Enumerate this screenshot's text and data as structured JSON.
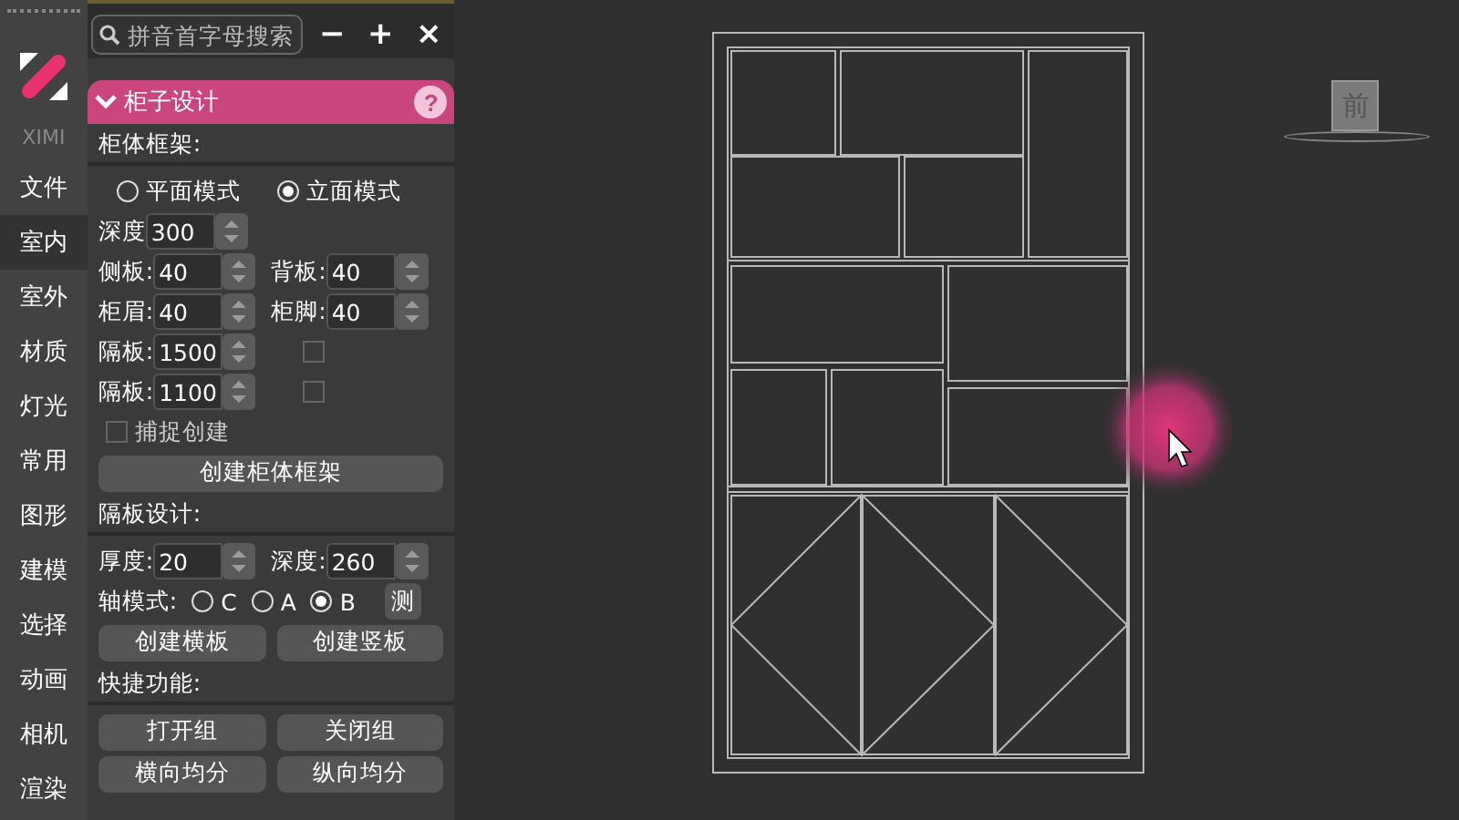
{
  "sidebar": {
    "brand": "XIMI",
    "items": [
      {
        "label": "文件",
        "selected": false
      },
      {
        "label": "室内",
        "selected": true
      },
      {
        "label": "室外",
        "selected": false
      },
      {
        "label": "材质",
        "selected": false
      },
      {
        "label": "灯光",
        "selected": false
      },
      {
        "label": "常用",
        "selected": false
      },
      {
        "label": "图形",
        "selected": false
      },
      {
        "label": "建模",
        "selected": false
      },
      {
        "label": "选择",
        "selected": false
      },
      {
        "label": "动画",
        "selected": false
      },
      {
        "label": "相机",
        "selected": false
      },
      {
        "label": "渲染",
        "selected": false
      }
    ]
  },
  "panel": {
    "search": {
      "placeholder": "拼音首字母搜索"
    },
    "tools": [
      "−",
      "+",
      "×"
    ],
    "header": {
      "title": "柜子设计",
      "expanded": true,
      "help": "?"
    },
    "form": [
      {
        "kind": "heading",
        "text": "柜体框架:"
      },
      {
        "kind": "radios",
        "options": [
          {
            "label": "平面模式",
            "selected": false
          },
          {
            "label": "立面模式",
            "selected": true
          }
        ]
      },
      {
        "kind": "fields",
        "fields": [
          {
            "label": "深度",
            "value": "300"
          }
        ]
      },
      {
        "kind": "fields",
        "fields": [
          {
            "label": "侧板:",
            "value": "40"
          },
          {
            "label": "背板:",
            "value": "40"
          }
        ]
      },
      {
        "kind": "fields",
        "fields": [
          {
            "label": "柜眉:",
            "value": "40"
          },
          {
            "label": "柜脚:",
            "value": "40"
          }
        ]
      },
      {
        "kind": "fields",
        "fields": [
          {
            "label": "隔板:",
            "value": "1500",
            "checked": false
          }
        ]
      },
      {
        "kind": "fields",
        "fields": [
          {
            "label": "隔板:",
            "value": "1100",
            "checked": false
          }
        ]
      },
      {
        "kind": "checkbox",
        "label": "捕捉创建",
        "checked": false
      },
      {
        "kind": "buttons",
        "labels": [
          "创建柜体框架"
        ]
      },
      {
        "kind": "heading",
        "text": "隔板设计:"
      },
      {
        "kind": "fields",
        "fields": [
          {
            "label": "厚度:",
            "value": "20"
          },
          {
            "label": "深度:",
            "value": "260"
          }
        ]
      },
      {
        "kind": "radios",
        "label": "轴模式:",
        "options": [
          {
            "label": "C",
            "selected": false
          },
          {
            "label": "A",
            "selected": false
          },
          {
            "label": "B",
            "selected": true
          }
        ],
        "action": "测"
      },
      {
        "kind": "buttons",
        "labels": [
          "创建横板",
          "创建竖板"
        ]
      },
      {
        "kind": "heading",
        "text": "快捷功能:"
      },
      {
        "kind": "buttons",
        "labels": [
          "打开组",
          "关闭组"
        ]
      },
      {
        "kind": "buttons",
        "labels": [
          "横向均分",
          "纵向均分"
        ]
      }
    ]
  },
  "viewport": {
    "view_cube": "前"
  }
}
